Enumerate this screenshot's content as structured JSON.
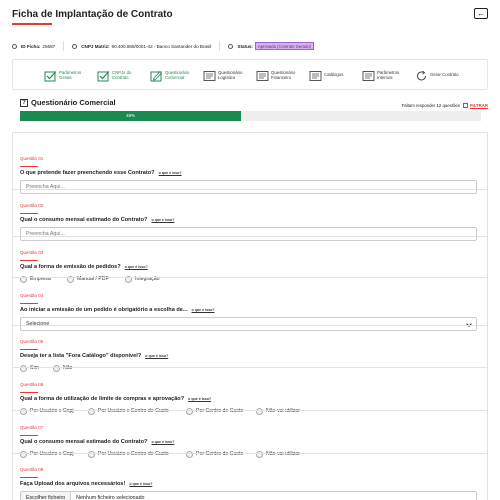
{
  "header": {
    "title": "Ficha de Implantação de Contrato",
    "back_icon": "arrow-left-icon"
  },
  "info": {
    "id_label": "ID Ficha:",
    "id_value": "25687",
    "cnpj_label": "CNPJ Matriz:",
    "cnpj_value": "90.400.888/0001-42 - Banco Santander do Brasil",
    "status_label": "Status:",
    "status_value": "Aprovada (Contrato Gerado)",
    "status_color": "#d7b4f0"
  },
  "steps": [
    {
      "label": "Parâmetros Gerais",
      "icon": "check-box-icon",
      "state": "done"
    },
    {
      "label": "CNPJs do Contrato",
      "icon": "check-box-icon",
      "state": "done"
    },
    {
      "label": "Questionário Comercial",
      "icon": "edit-checkbox-icon",
      "state": "current"
    },
    {
      "label": "Questionário Logístico",
      "icon": "document-icon",
      "state": "todo"
    },
    {
      "label": "Questionário Financeiro",
      "icon": "document-icon",
      "state": "todo"
    },
    {
      "label": "Catálogos",
      "icon": "document-icon",
      "state": "todo"
    },
    {
      "label": "Parâmetros Internos",
      "icon": "document-icon",
      "state": "todo"
    },
    {
      "label": "Gerar Contrato",
      "icon": "refresh-icon",
      "state": "todo"
    }
  ],
  "section": {
    "title": "Questionário Comercial",
    "missing_text": "Faltam responder 12 questões",
    "filter_label": "FILTRAR",
    "progress_label": "48%",
    "progress_fraction": 0.48,
    "accent_color": "#1a8a52"
  },
  "why_label": "o que é isso?",
  "questions": [
    {
      "num": "Questão 01",
      "text": "O que pretende fazer preenchendo esse Contrato?",
      "placeholder": "Preencha Aqui..."
    },
    {
      "num": "Questão 02",
      "text": "Qual o consumo mensal estimado do Contrato?",
      "placeholder": "Preencha Aqui..."
    },
    {
      "num": "Questão 03",
      "text": "Qual a forma de emissão de pedidos?",
      "options": [
        "Empresa",
        "Manual / PDF",
        "Integração"
      ]
    },
    {
      "num": "Questão 04",
      "text": "Ao iniciar a emissão de um pedido é obrigatório a escolha de...",
      "select_value": "Selecione"
    },
    {
      "num": "Questão 05",
      "text": "Deseja ter a lista \"Fora Catálogo\" disponível?",
      "options": [
        "Sim",
        "Não"
      ]
    },
    {
      "num": "Questão 06",
      "text": "Qual a forma de utilização de limite de compras e aprovação?",
      "options": [
        "Por Usuário x Cnpj",
        "Por Usuário x Centro de Custo",
        "Por Centro de Custo",
        "Não vai utilizar"
      ]
    },
    {
      "num": "Questão 07",
      "text": "Qual o consumo mensal estimado do Contrato?",
      "options": [
        "Por Usuário x Cnpj",
        "Por Usuário x Centro de Custo",
        "Por Centro de Custo",
        "Não vai utilizar"
      ]
    },
    {
      "num": "Questão 08",
      "text": "Faça Upload dos arquivos necessários!",
      "file_button": "Escolher ficheiro",
      "file_status": "Nenhum ficheiro selecionado"
    }
  ]
}
